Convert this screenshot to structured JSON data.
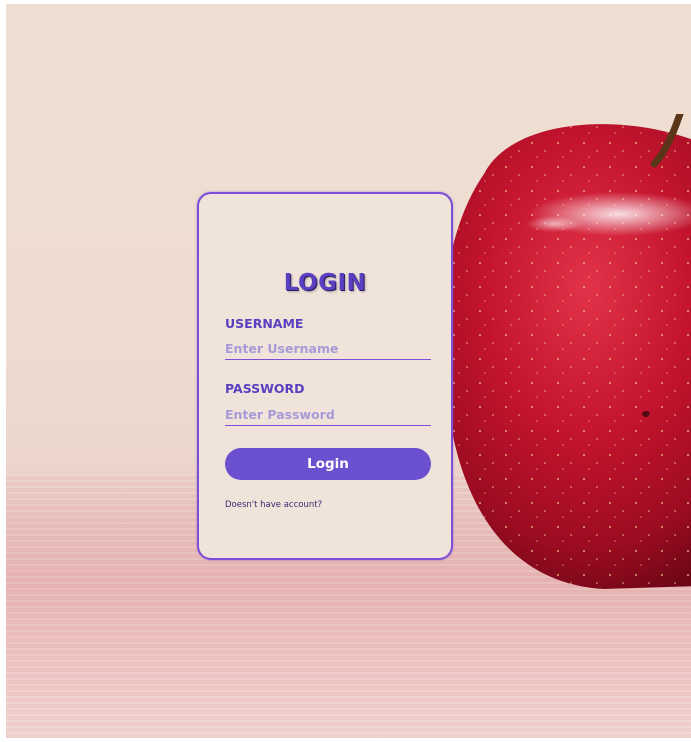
{
  "login": {
    "title": "LOGIN",
    "username_label": "USERNAME",
    "username_placeholder": "Enter Username",
    "username_value": "",
    "password_label": "PASSWORD",
    "password_placeholder": "Enter Password",
    "password_value": "",
    "submit_label": "Login",
    "account_link": "Doesn't have account?"
  },
  "colors": {
    "accent": "#6a50cf",
    "border": "#7c4fd6",
    "card_background": "#efe3da",
    "placeholder": "#a89ad8"
  }
}
